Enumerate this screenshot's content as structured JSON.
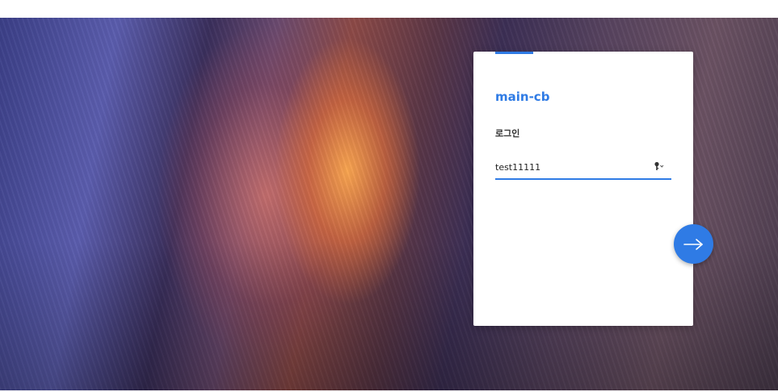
{
  "login_card": {
    "app_name": "main-cb",
    "section_label": "로그인",
    "username_value": "test11111"
  },
  "icons": {
    "password_manager": "key-icon",
    "next": "arrow-right-icon"
  },
  "colors": {
    "accent": "#2f7be5",
    "card_background": "#ffffff"
  }
}
